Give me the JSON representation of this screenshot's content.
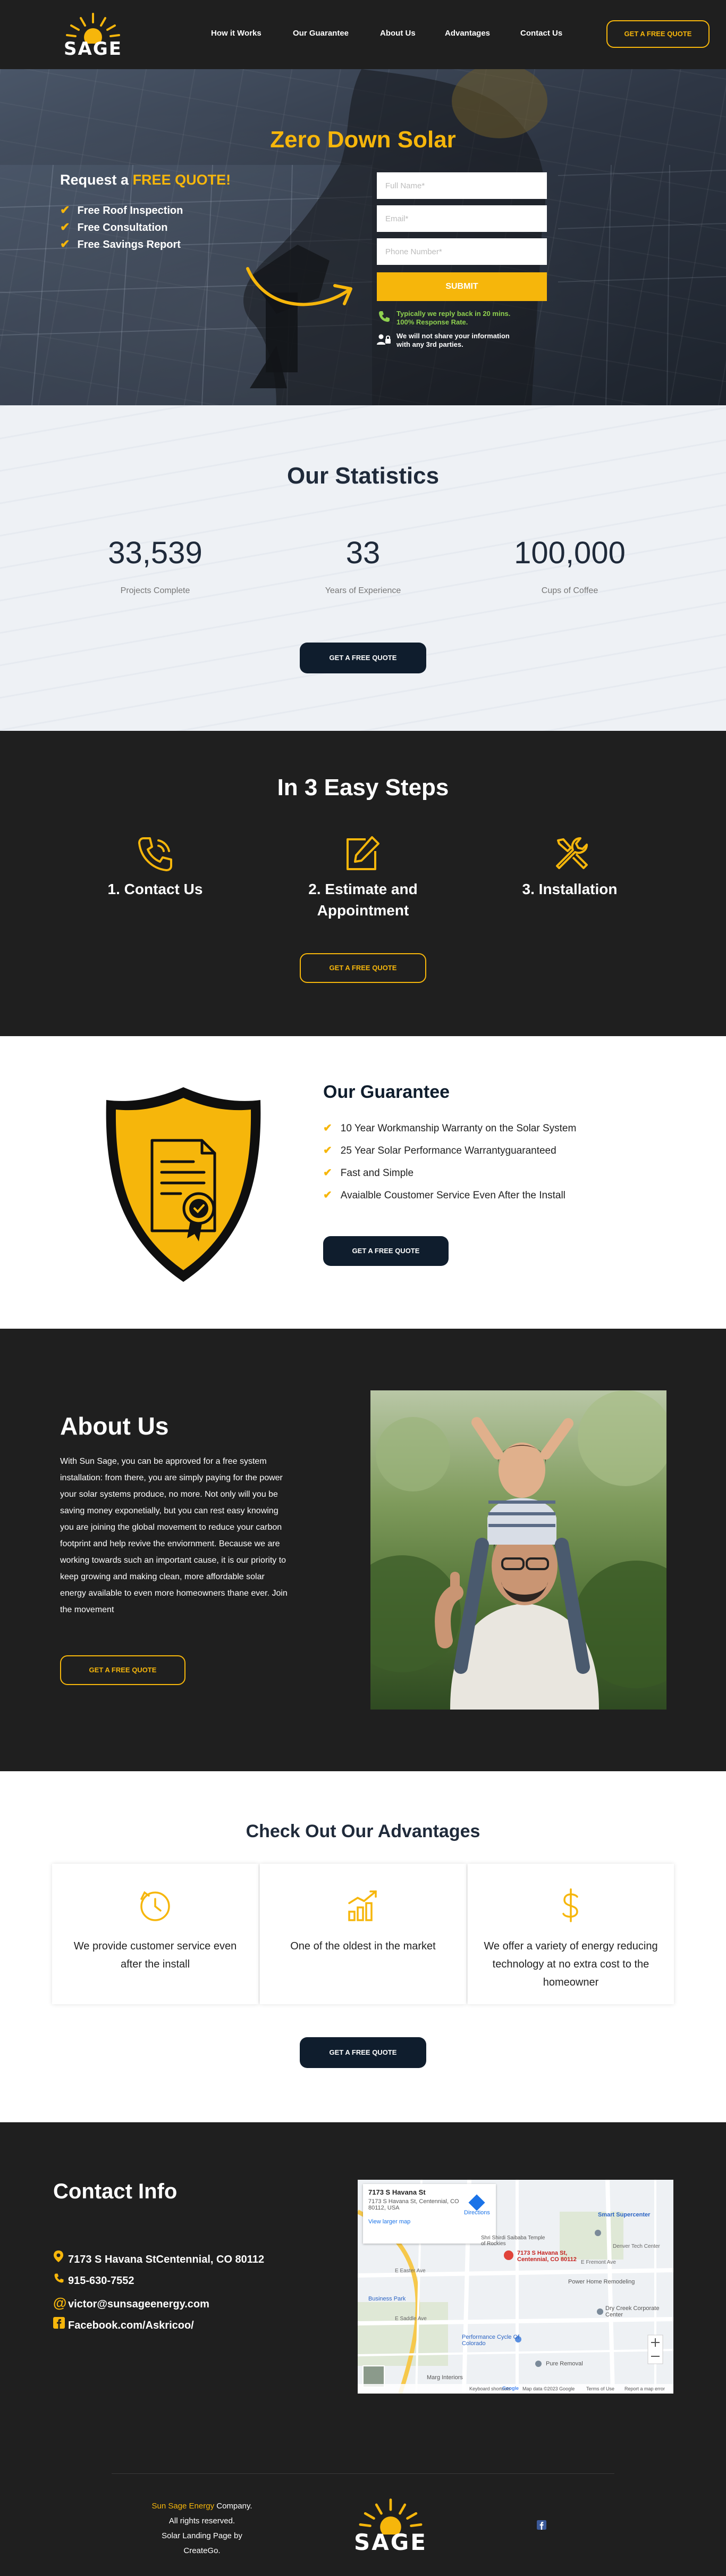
{
  "nav": {
    "brand": "SAGE",
    "links": [
      "How it Works",
      "Our Guarantee",
      "About Us",
      "Advantages",
      "Contact Us"
    ],
    "cta": "GET A FREE QUOTE"
  },
  "hero": {
    "title": "Zero Down Solar",
    "request_prefix": "Request a",
    "request_highlight": "FREE QUOTE!",
    "features": [
      "Free Roof Inspection",
      "Free Consultation",
      "Free Savings Report"
    ],
    "form": {
      "name_placeholder": "Full Name*",
      "email_placeholder": "Email*",
      "phone_placeholder": "Phone Number*",
      "submit": "SUBMIT"
    },
    "note_response_line1": "Typically we reply back in 20 mins.",
    "note_response_line2": "100% Response Rate.",
    "note_privacy_line1": "We will not share your information",
    "note_privacy_line2": "with any 3rd parties."
  },
  "stats": {
    "title": "Our Statistics",
    "items": [
      {
        "value": "33,539",
        "label": "Projects Complete"
      },
      {
        "value": "33",
        "label": "Years of Experience"
      },
      {
        "value": "100,000",
        "label": "Cups of Coffee"
      }
    ],
    "cta": "GET A FREE QUOTE"
  },
  "steps": {
    "title": "In 3 Easy Steps",
    "items": [
      {
        "label": "1. Contact Us",
        "icon": "phone-icon"
      },
      {
        "label_line1": "2. Estimate and",
        "label_line2": "Appointment",
        "icon": "edit-icon"
      },
      {
        "label": "3. Installation",
        "icon": "tools-icon"
      }
    ],
    "cta": "GET A FREE QUOTE"
  },
  "guarantee": {
    "title": "Our Guarantee",
    "items": [
      "10 Year Workmanship Warranty on the Solar System",
      "25 Year Solar Performance Warrantyguaranteed",
      "Fast and Simple",
      "Avaialble Coustomer Service Even After the Install"
    ],
    "cta": "GET A FREE QUOTE"
  },
  "about": {
    "title": "About Us",
    "body": "With Sun Sage, you can be approved for a free system installation: from there, you are simply paying for the power your solar systems produce, no more. Not only will you be saving money exponetially, but you can rest easy knowing you are joining the global movement to reduce your carbon footprint and help revive the enviornment. Because we are working towards such an important cause, it is our priority to keep growing and making clean, more affordable solar energy available to even more homeowners thane ever. Join the movement",
    "cta": "GET A FREE QUOTE"
  },
  "advantages": {
    "title": "Check Out Our Advantages",
    "items": [
      {
        "text": "We provide customer service even after the install",
        "icon": "clock-icon"
      },
      {
        "text": "One of the oldest in the market",
        "icon": "growth-chart-icon"
      },
      {
        "text": "We offer a variety of energy reducing technology at no extra cost to the homeowner",
        "icon": "dollar-icon"
      }
    ],
    "cta": "GET A FREE QUOTE"
  },
  "contact": {
    "title": "Contact Info",
    "address": "7173 S Havana StCentennial, CO 80112",
    "phone": "915-630-7552",
    "email": "victor@sunsageenergy.com",
    "facebook": "Facebook.com/Askricoo/",
    "map": {
      "place_title": "7173 S Havana St",
      "place_addr1": "7173 S Havana St, Centennial, CO",
      "place_addr2": "80112, USA",
      "directions": "Directions",
      "view_larger": "View larger map",
      "labels": [
        "Smart Supercenter",
        "Shri Shirdi Saibaba Temple of Rockies",
        "7173 S Havana St, Centennial, CO 80112",
        "Power Home Remodeling",
        "Dry Creek Corporate Center",
        "Performance Cycle Of Colorado",
        "Pure Removal",
        "Business Park",
        "Marg Interiors",
        "E Easter Ave",
        "E Saddle Ave",
        "E Fremont Ave",
        "Denver Tech Center"
      ],
      "footer_items": [
        "Google",
        "Keyboard shortcuts",
        "Map data ©2023 Google",
        "Terms of Use",
        "Report a map error"
      ]
    }
  },
  "footer": {
    "company_highlight": "Sun Sage Energy",
    "company_suffix": " Company.",
    "rights": "All rights reserved.",
    "credit": "Solar Landing Page by CreateGo.",
    "brand": "SAGE"
  },
  "colors": {
    "accent": "#f6b60b",
    "navy": "#0f1d2d",
    "dark": "#1f1f1f"
  }
}
